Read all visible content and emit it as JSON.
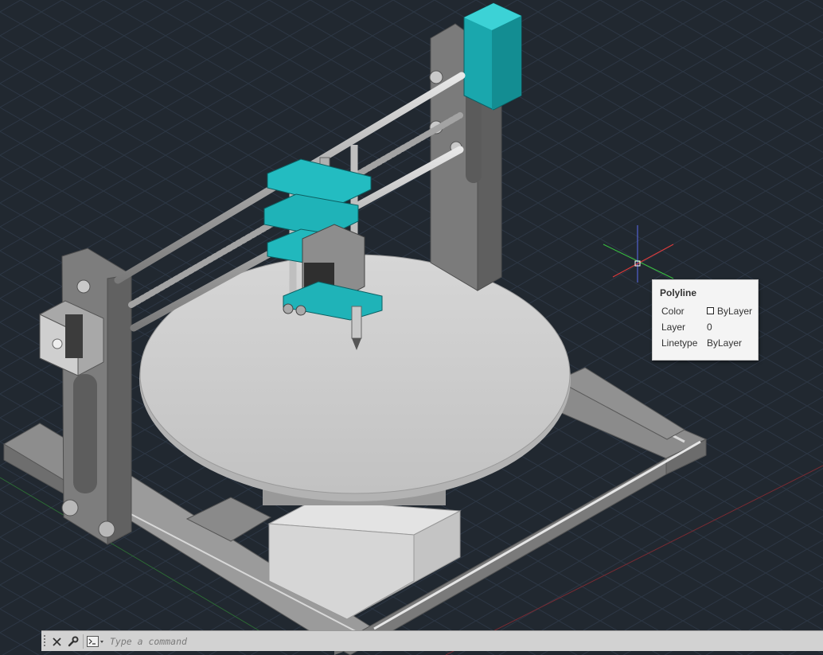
{
  "tooltip": {
    "title": "Polyline",
    "rows": [
      {
        "label": "Color",
        "value": "ByLayer",
        "swatch": "#ffffff"
      },
      {
        "label": "Layer",
        "value": "0"
      },
      {
        "label": "Linetype",
        "value": "ByLayer"
      }
    ]
  },
  "command_bar": {
    "placeholder": "Type a command",
    "close_icon": "close-icon",
    "customize_icon": "wrench-icon",
    "prompt_icon": "command-prompt-icon"
  },
  "colors": {
    "background": "#212830",
    "grid": "#2c3644",
    "part_teal": "#1fb8bd",
    "part_gray": "#8a8a8a",
    "bed": "#c9c9c9"
  }
}
